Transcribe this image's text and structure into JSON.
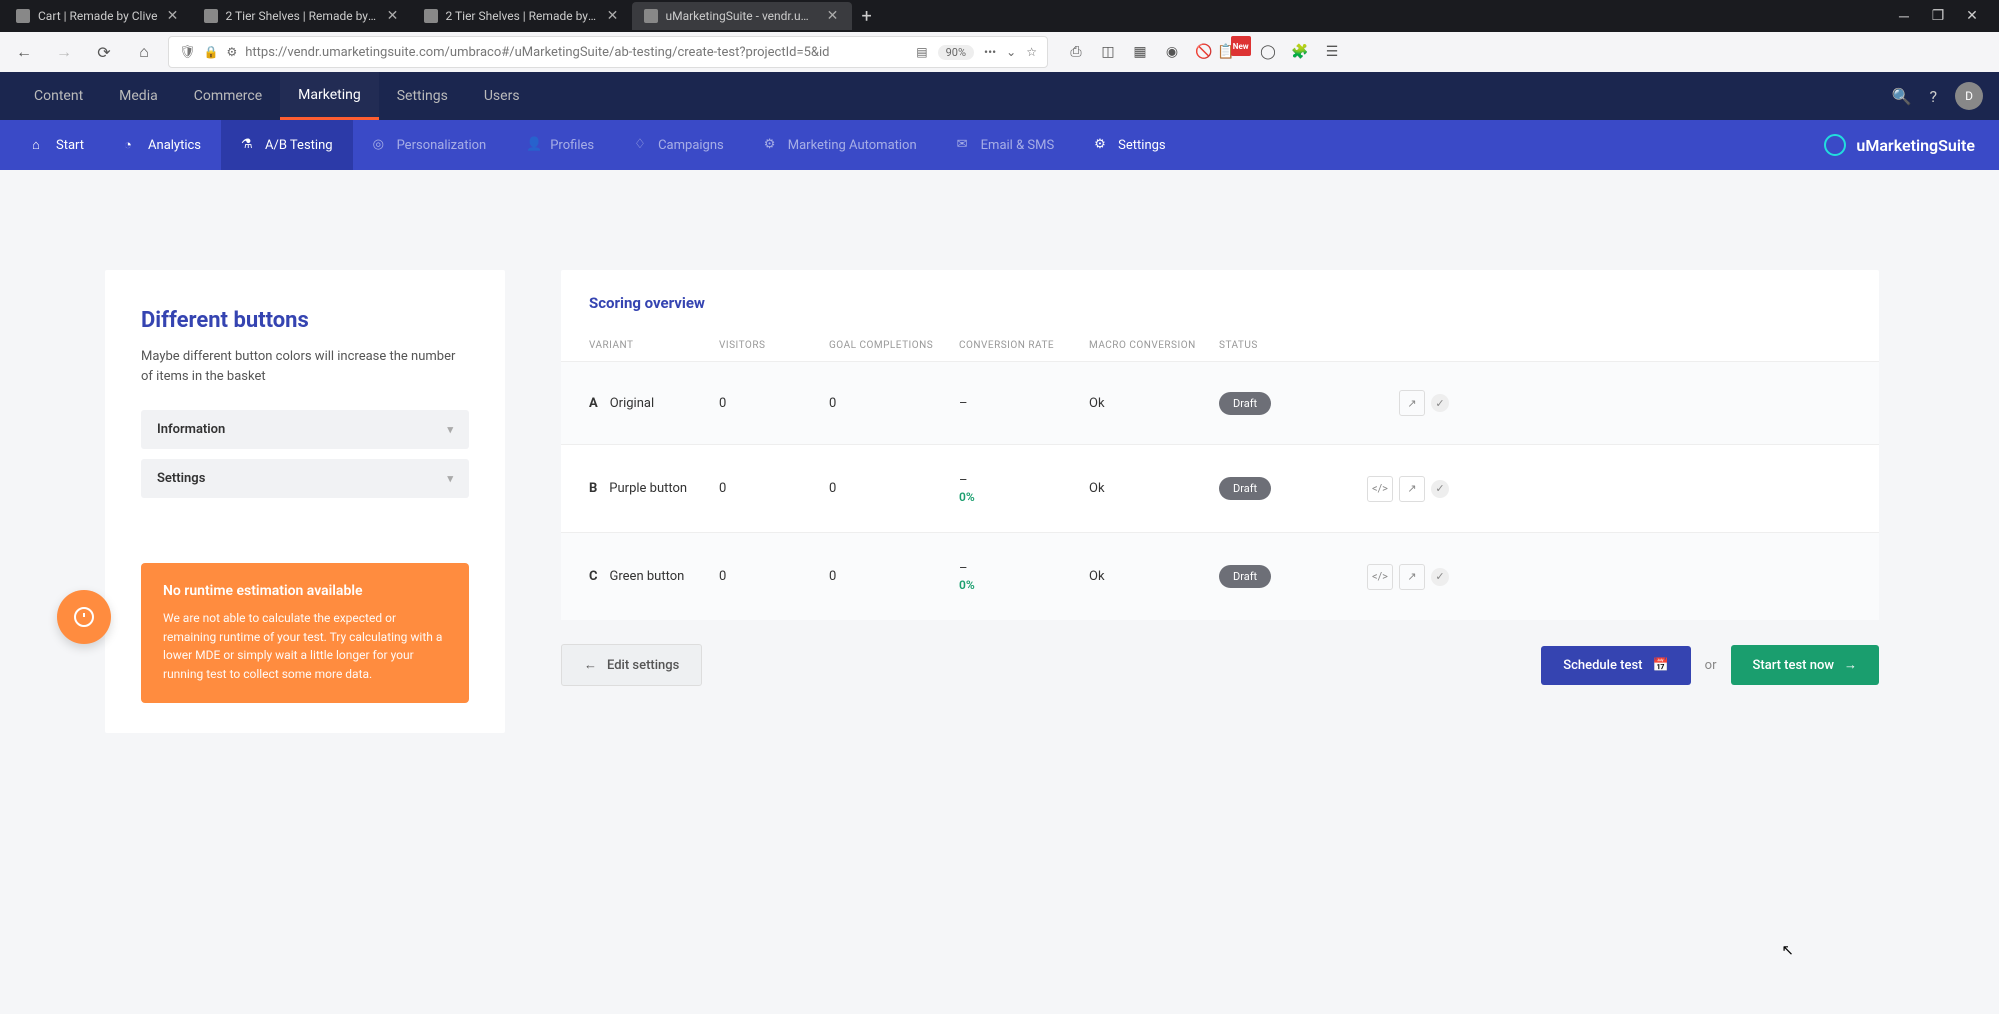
{
  "browser": {
    "tabs": [
      {
        "title": "Cart | Remade by Clive",
        "active": false
      },
      {
        "title": "2 Tier Shelves | Remade by Cliv",
        "active": false
      },
      {
        "title": "2 Tier Shelves | Remade by Cli",
        "active": false
      },
      {
        "title": "uMarketingSuite - vendr.umark",
        "active": true
      }
    ],
    "url": "https://vendr.umarketingsuite.com/umbraco#/uMarketingSuite/ab-testing/create-test?projectId=5&id",
    "zoom": "90%"
  },
  "app_nav": {
    "items": [
      "Content",
      "Media",
      "Commerce",
      "Marketing",
      "Settings",
      "Users"
    ],
    "active": "Marketing",
    "avatar": "D"
  },
  "sub_nav": {
    "items": [
      {
        "label": "Start",
        "state": "enabled"
      },
      {
        "label": "Analytics",
        "state": "enabled"
      },
      {
        "label": "A/B Testing",
        "state": "active"
      },
      {
        "label": "Personalization",
        "state": "disabled"
      },
      {
        "label": "Profiles",
        "state": "disabled"
      },
      {
        "label": "Campaigns",
        "state": "disabled"
      },
      {
        "label": "Marketing Automation",
        "state": "disabled"
      },
      {
        "label": "Email & SMS",
        "state": "disabled"
      },
      {
        "label": "Settings",
        "state": "enabled"
      }
    ],
    "brand": "uMarketingSuite"
  },
  "left": {
    "title": "Different buttons",
    "desc": "Maybe different button colors will increase the number of items in the basket",
    "accordion1": "Information",
    "accordion2": "Settings",
    "alert_title": "No runtime estimation available",
    "alert_text": "We are not able to calculate the expected or remaining runtime of your test. Try calculating with a lower MDE or simply wait a little longer for your running test to collect some more data."
  },
  "scoring": {
    "title": "Scoring overview",
    "columns": [
      "VARIANT",
      "VISITORS",
      "GOAL COMPLETIONS",
      "CONVERSION RATE",
      "MACRO CONVERSION",
      "STATUS"
    ],
    "rows": [
      {
        "letter": "A",
        "name": "Original",
        "visitors": "0",
        "goals": "0",
        "conv": "–",
        "conv_sub": "",
        "macro": "Ok",
        "status": "Draft",
        "hasCode": false
      },
      {
        "letter": "B",
        "name": "Purple button",
        "visitors": "0",
        "goals": "0",
        "conv": "–",
        "conv_sub": "0%",
        "macro": "Ok",
        "status": "Draft",
        "hasCode": true
      },
      {
        "letter": "C",
        "name": "Green button",
        "visitors": "0",
        "goals": "0",
        "conv": "–",
        "conv_sub": "0%",
        "macro": "Ok",
        "status": "Draft",
        "hasCode": true
      }
    ]
  },
  "actions": {
    "edit": "Edit settings",
    "schedule": "Schedule test",
    "or": "or",
    "start": "Start test now"
  }
}
